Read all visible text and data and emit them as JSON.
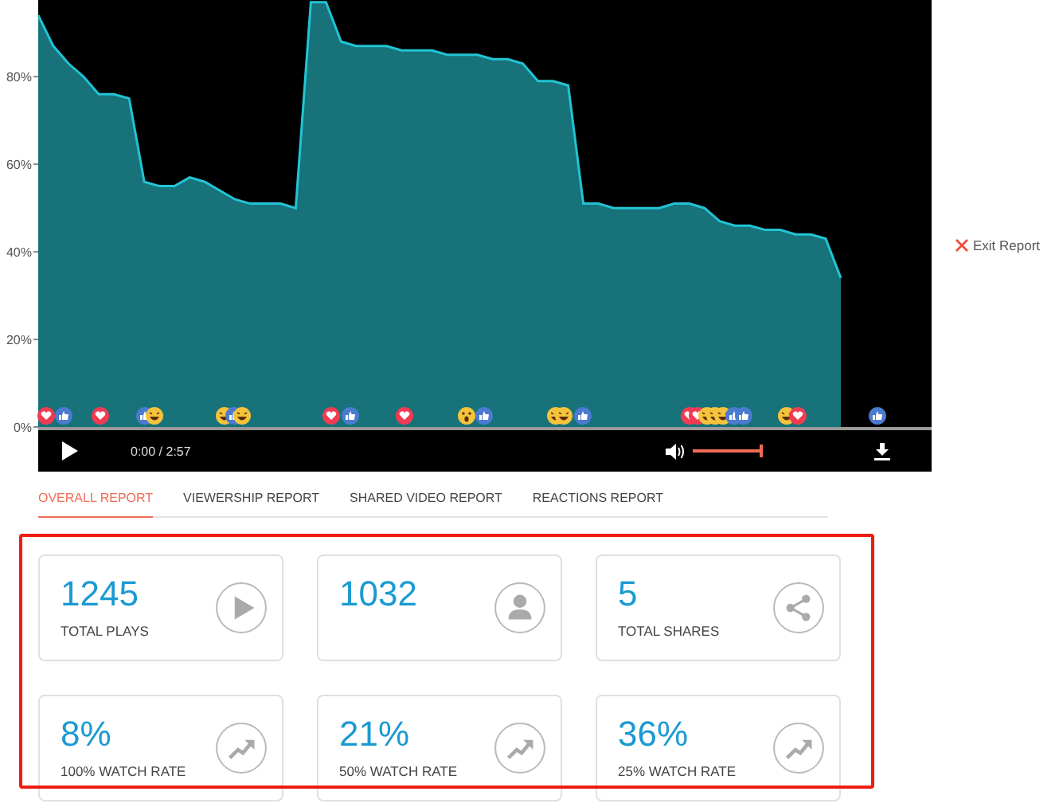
{
  "chart_data": {
    "type": "area",
    "ylim": [
      0,
      97.5
    ],
    "yticks": [
      {
        "value": 0,
        "label": "0%"
      },
      {
        "value": 20,
        "label": "20%"
      },
      {
        "value": 40,
        "label": "40%"
      },
      {
        "value": 60,
        "label": "60%"
      },
      {
        "value": 80,
        "label": "80%"
      }
    ],
    "categories": [
      null,
      null,
      null,
      null,
      null,
      null,
      null,
      null,
      null,
      null,
      null,
      null,
      null,
      null,
      null,
      null,
      null,
      null,
      null,
      null,
      null,
      null,
      null,
      null,
      null,
      null,
      null,
      null,
      null,
      null,
      null,
      null,
      null,
      null,
      null,
      null,
      null,
      null,
      null,
      null,
      null,
      null,
      null,
      null,
      null,
      null,
      null,
      null,
      null,
      null,
      null,
      null,
      null,
      null
    ],
    "series": [
      {
        "color": "#22c4d4",
        "values": [
          94,
          87,
          83,
          80,
          76,
          76,
          75,
          56,
          55,
          55,
          57,
          56,
          54,
          52,
          51,
          51,
          51,
          50,
          97,
          97,
          88,
          87,
          87,
          87,
          86,
          86,
          86,
          85,
          85,
          85,
          84,
          84,
          83,
          79,
          79,
          78,
          51,
          51,
          50,
          50,
          50,
          50,
          51,
          51,
          50,
          47,
          46,
          46,
          45,
          45,
          44,
          44,
          43,
          34
        ]
      }
    ]
  },
  "reactions": [
    {
      "kind": "love"
    },
    {
      "kind": "like"
    },
    {
      "kind": "love"
    },
    {
      "kind": "like"
    },
    {
      "kind": "haha"
    },
    {
      "kind": "haha"
    },
    {
      "kind": "like"
    },
    {
      "kind": "haha"
    },
    {
      "kind": "love"
    },
    {
      "kind": "like"
    },
    {
      "kind": "love"
    },
    {
      "kind": "wow"
    },
    {
      "kind": "like"
    },
    {
      "kind": "haha"
    },
    {
      "kind": "haha"
    },
    {
      "kind": "like"
    },
    {
      "kind": "love"
    },
    {
      "kind": "love"
    },
    {
      "kind": "haha"
    },
    {
      "kind": "haha"
    },
    {
      "kind": "haha"
    },
    {
      "kind": "like"
    },
    {
      "kind": "like"
    },
    {
      "kind": "haha"
    },
    {
      "kind": "love"
    },
    {
      "kind": "like"
    }
  ],
  "player": {
    "time": "0:00 / 2:57",
    "volume": {
      "level": 1
    }
  },
  "exit_link": "Exit Report",
  "tabs": [
    {
      "label": "OVERALL REPORT",
      "selected": true
    },
    {
      "label": "VIEWERSHIP REPORT",
      "selected": false
    },
    {
      "label": "SHARED VIDEO REPORT",
      "selected": false
    },
    {
      "label": "REACTIONS REPORT",
      "selected": false
    }
  ],
  "cards": [
    {
      "value": "1245",
      "label": "TOTAL PLAYS"
    },
    {
      "value": "1032"
    },
    {
      "value": "5",
      "label": "TOTAL SHARES"
    },
    {
      "value": "8%",
      "label": "100% WATCH RATE"
    },
    {
      "value": "21%",
      "label": "50% WATCH RATE"
    },
    {
      "value": "36%",
      "label": "25% WATCH RATE"
    }
  ]
}
